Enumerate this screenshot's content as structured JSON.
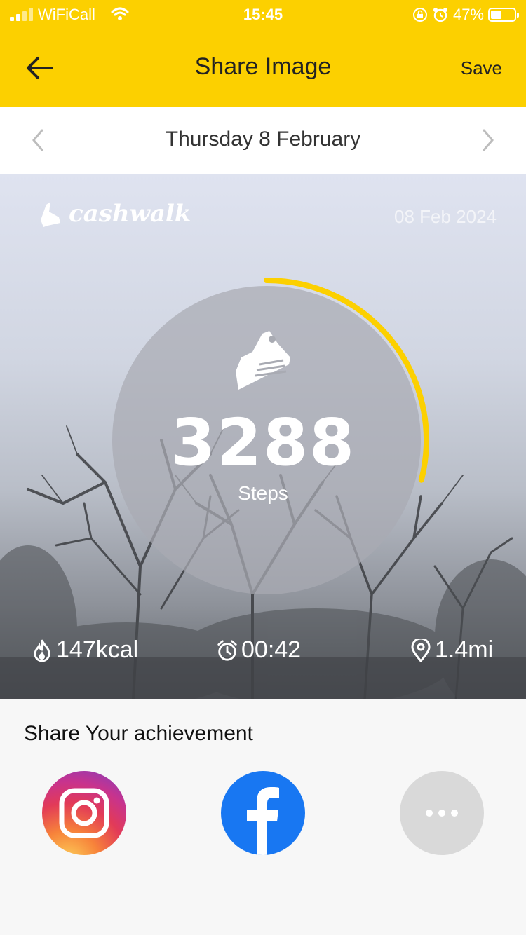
{
  "status_bar": {
    "carrier": "WiFiCall",
    "time": "15:45",
    "battery": "47%",
    "battery_level": 0.47
  },
  "header": {
    "title": "Share Image",
    "save_label": "Save"
  },
  "date_nav": {
    "date": "Thursday 8 February"
  },
  "card": {
    "brand": "cashwalk",
    "date": "08 Feb 2024",
    "steps": "3288",
    "steps_label": "Steps",
    "goal_progress": 0.29,
    "calories": "147kcal",
    "duration": "00:42",
    "distance": "1.4mi"
  },
  "share": {
    "title": "Share Your achievement",
    "options": [
      "instagram-icon",
      "facebook-icon",
      "more-icon"
    ]
  },
  "colors": {
    "accent": "#fcd000",
    "facebook": "#1877f2"
  }
}
